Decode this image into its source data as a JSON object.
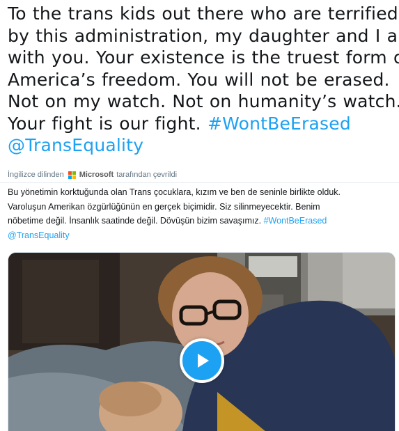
{
  "tweet": {
    "lines": [
      "To the trans kids out there who are terrified",
      "by this administration, my daughter and I are",
      "with you. Your existence is the truest form of",
      "America’s freedom. You will not be erased.",
      "Not on my watch. Not on humanity’s watch.",
      "Your fight is our fight."
    ],
    "hashtag": "#WontBeErased",
    "mention": "@TransEquality"
  },
  "translation": {
    "prefix": "İngilizce dilinden",
    "provider": "Microsoft",
    "suffix": "tarafından çevrildi",
    "lines": [
      "Bu yönetimin korktuğunda olan Trans çocuklara, kızım ve ben de seninle birlikte olduk.",
      "Varoluşun Amerikan özgürlüğünün en gerçek biçimidir. Siz silinmeyecektir. Benim",
      "nöbetime değil. İnsanlık saatinde değil. Dövüşün bizim savaşımız."
    ],
    "hashtag": "#WontBeErased",
    "mention": "@TransEquality"
  },
  "media": {
    "type": "video",
    "play_icon": "play-icon"
  },
  "colors": {
    "link": "#1da1f2",
    "text": "#14171a",
    "muted": "#657786",
    "ms_red": "#f25022",
    "ms_green": "#7fba00",
    "ms_blue": "#00a4ef",
    "ms_yellow": "#ffb900"
  }
}
